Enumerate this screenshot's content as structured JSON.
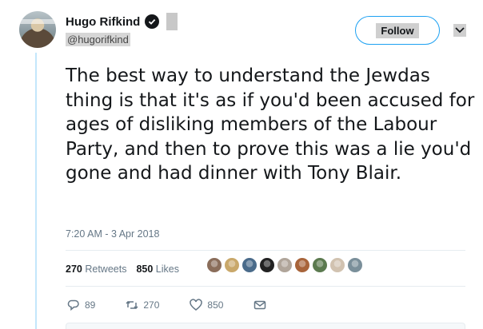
{
  "tweet": {
    "display_name": "Hugo Rifkind",
    "handle": "@hugorifkind",
    "verified": true,
    "follow_label": "Follow",
    "text": "The best way to understand the Jewdas thing is that it's as if you'd been accused for ages of disliking members of the Labour Party, and then to prove this was a lie you'd gone and had dinner with Tony Blair.",
    "timestamp": "7:20 AM - 3 Apr 2018",
    "retweets_count": "270",
    "retweets_label": "Retweets",
    "likes_count": "850",
    "likes_label": "Likes",
    "liker_avatar_colors": [
      "#8a6d5a",
      "#c9a86a",
      "#4a6b8a",
      "#222222",
      "#b0a59a",
      "#a8643a",
      "#5b7a4f",
      "#d1c2b0",
      "#7a8f9a"
    ],
    "actions": {
      "reply_count": "89",
      "retweet_count": "270",
      "like_count": "850"
    }
  },
  "colors": {
    "accent": "#1da1f2",
    "thread_line": "#c4e7fb",
    "muted": "#657786"
  },
  "icons": [
    "verified-badge-icon",
    "chevron-down-icon",
    "reply-icon",
    "retweet-icon",
    "like-heart-icon",
    "direct-message-icon"
  ]
}
